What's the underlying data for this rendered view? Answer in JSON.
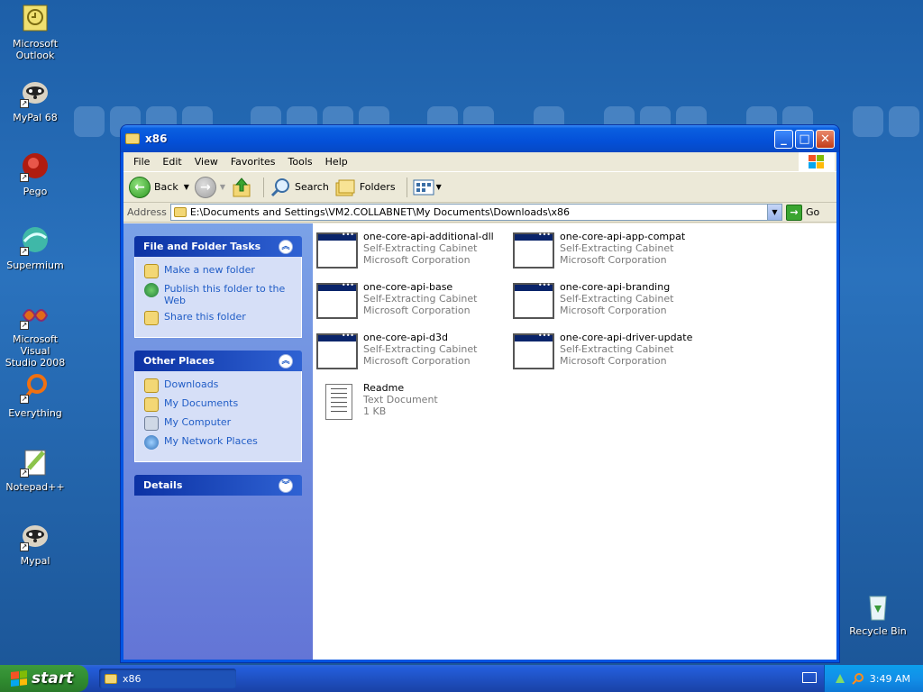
{
  "desktop": {
    "icons": [
      {
        "label": "Microsoft\nOutlook",
        "icon": "outlook-icon"
      },
      {
        "label": "MyPal 68",
        "icon": "mypal-icon"
      },
      {
        "label": "Pego",
        "icon": "pego-icon"
      },
      {
        "label": "Supermium",
        "icon": "supermium-icon"
      },
      {
        "label": "Microsoft Visual\nStudio 2008",
        "icon": "visual-studio-icon"
      },
      {
        "label": "Everything",
        "icon": "everything-icon"
      },
      {
        "label": "Notepad++",
        "icon": "notepadpp-icon"
      },
      {
        "label": "Mypal",
        "icon": "mypal-icon"
      }
    ],
    "recycle_bin": "Recycle Bin"
  },
  "window": {
    "title": "x86",
    "menu": [
      "File",
      "Edit",
      "View",
      "Favorites",
      "Tools",
      "Help"
    ],
    "toolbar": {
      "back": "Back",
      "search": "Search",
      "folders": "Folders"
    },
    "address": {
      "label": "Address",
      "path": "E:\\Documents and Settings\\VM2.COLLABNET\\My Documents\\Downloads\\x86",
      "go": "Go"
    }
  },
  "tasks": {
    "file_folder": {
      "title": "File and Folder Tasks",
      "items": [
        "Make a new folder",
        "Publish this folder to the Web",
        "Share this folder"
      ]
    },
    "other_places": {
      "title": "Other Places",
      "items": [
        "Downloads",
        "My Documents",
        "My Computer",
        "My Network Places"
      ]
    },
    "details": {
      "title": "Details"
    }
  },
  "files": [
    {
      "name": "one-core-api-additional-dll",
      "type": "Self-Extracting Cabinet",
      "info": "Microsoft Corporation",
      "icon": "cabinet-icon"
    },
    {
      "name": "one-core-api-app-compat",
      "type": "Self-Extracting Cabinet",
      "info": "Microsoft Corporation",
      "icon": "cabinet-icon"
    },
    {
      "name": "one-core-api-base",
      "type": "Self-Extracting Cabinet",
      "info": "Microsoft Corporation",
      "icon": "cabinet-icon"
    },
    {
      "name": "one-core-api-branding",
      "type": "Self-Extracting Cabinet",
      "info": "Microsoft Corporation",
      "icon": "cabinet-icon"
    },
    {
      "name": "one-core-api-d3d",
      "type": "Self-Extracting Cabinet",
      "info": "Microsoft Corporation",
      "icon": "cabinet-icon"
    },
    {
      "name": "one-core-api-driver-update",
      "type": "Self-Extracting Cabinet",
      "info": "Microsoft Corporation",
      "icon": "cabinet-icon"
    },
    {
      "name": "Readme",
      "type": "Text Document",
      "info": "1 KB",
      "icon": "text-document-icon"
    }
  ],
  "taskbar": {
    "start": "start",
    "task": "x86",
    "clock": "3:49 AM"
  }
}
